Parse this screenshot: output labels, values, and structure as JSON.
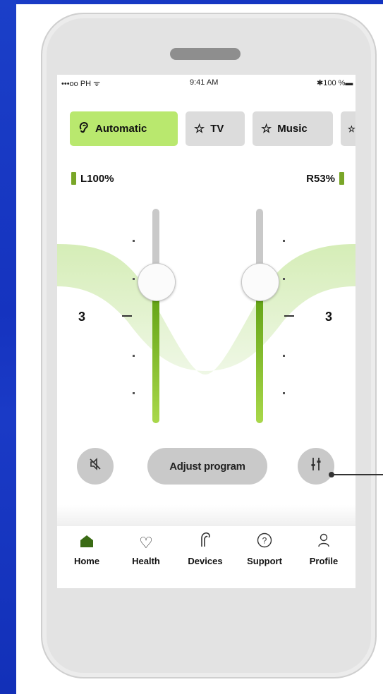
{
  "status_bar": {
    "carrier": "•••oo PH ᯤ",
    "time": "9:41 AM",
    "battery": "✱100 %▬"
  },
  "programs": [
    {
      "label": "Automatic",
      "icon": "ear-icon",
      "active": true
    },
    {
      "label": "TV",
      "icon": "star-icon",
      "active": false
    },
    {
      "label": "Music",
      "icon": "star-icon",
      "active": false
    }
  ],
  "battery": {
    "left": "L100%",
    "right": "R53%"
  },
  "volume": {
    "left_value": "3",
    "right_value": "3",
    "left_level": 0.66,
    "right_level": 0.66
  },
  "buttons": {
    "mute_icon": "speaker-muted-icon",
    "adjust_label": "Adjust program",
    "equalizer_icon": "equalizer-sliders-icon"
  },
  "nav": [
    {
      "label": "Home",
      "icon": "home-icon",
      "active": true
    },
    {
      "label": "Health",
      "icon": "heart-icon",
      "active": false
    },
    {
      "label": "Devices",
      "icon": "hearing-aid-icon",
      "active": false
    },
    {
      "label": "Support",
      "icon": "question-icon",
      "active": false
    },
    {
      "label": "Profile",
      "icon": "person-icon",
      "active": false
    }
  ],
  "colors": {
    "accent_green": "#b9e86e",
    "slider_green": "#6aa81a",
    "frame_blue": "#1a3cc6"
  }
}
